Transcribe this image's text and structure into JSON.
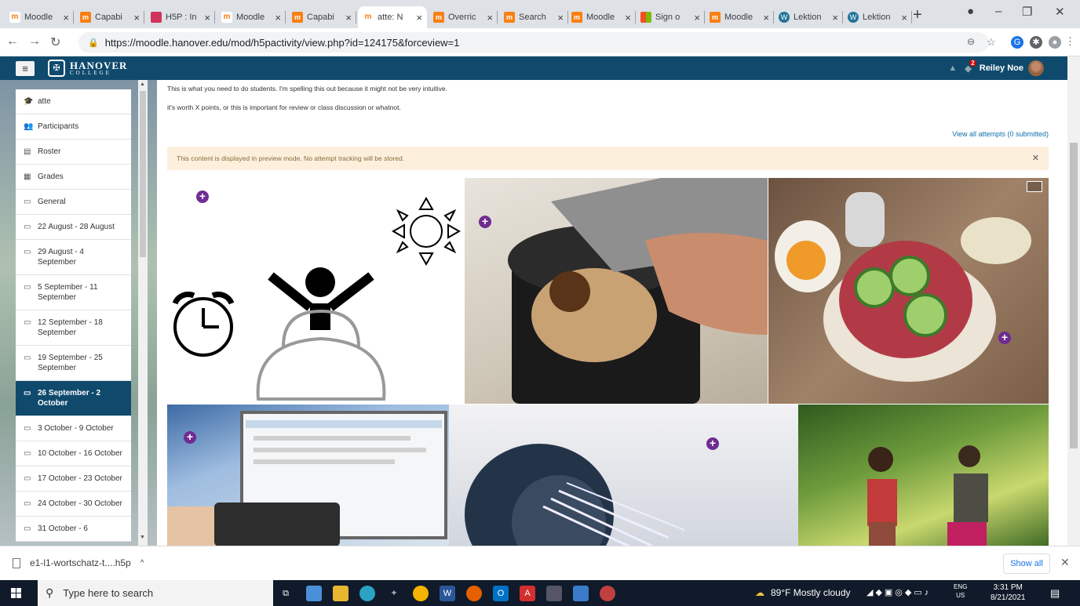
{
  "browser": {
    "tabs": [
      {
        "title": "Moodle",
        "icon": "moodle"
      },
      {
        "title": "Capabi",
        "icon": "m"
      },
      {
        "title": "H5P : In",
        "icon": "h5p"
      },
      {
        "title": "Moodle",
        "icon": "moodle"
      },
      {
        "title": "Capabi",
        "icon": "m"
      },
      {
        "title": "atte: N",
        "icon": "moodle",
        "active": true
      },
      {
        "title": "Overric",
        "icon": "m"
      },
      {
        "title": "Search",
        "icon": "m"
      },
      {
        "title": "Moodle",
        "icon": "m"
      },
      {
        "title": "Sign o",
        "icon": "ms"
      },
      {
        "title": "Moodle",
        "icon": "m"
      },
      {
        "title": "Lektion",
        "icon": "wp"
      },
      {
        "title": "Lektion",
        "icon": "wp"
      }
    ],
    "url": "https://moodle.hanover.edu/mod/h5pactivity/view.php?id=124175&forceview=1",
    "new_tab": "+",
    "close_glyph": "×"
  },
  "site": {
    "logo_name": "HANOVER",
    "logo_sub": "COLLEGE",
    "notification_count": "2",
    "user_name": "Reiley Noe"
  },
  "drawer": {
    "items": [
      {
        "label": "atte",
        "icon": "hat-icon"
      },
      {
        "label": "Participants",
        "icon": "people-icon"
      },
      {
        "label": "Roster",
        "icon": "roster-icon"
      },
      {
        "label": "Grades",
        "icon": "table-icon"
      },
      {
        "label": "General",
        "icon": "folder-icon"
      },
      {
        "label": "22 August - 28 August",
        "icon": "folder-icon"
      },
      {
        "label": "29 August - 4 September",
        "icon": "folder-icon"
      },
      {
        "label": "5 September - 11 September",
        "icon": "folder-icon"
      },
      {
        "label": "12 September - 18 September",
        "icon": "folder-icon"
      },
      {
        "label": "19 September - 25 September",
        "icon": "folder-icon"
      },
      {
        "label": "26 September - 2 October",
        "icon": "folder-icon",
        "active": true
      },
      {
        "label": "3 October - 9 October",
        "icon": "folder-icon"
      },
      {
        "label": "10 October - 16 October",
        "icon": "folder-icon"
      },
      {
        "label": "17 October - 23 October",
        "icon": "folder-icon"
      },
      {
        "label": "24 October - 30 October",
        "icon": "folder-icon"
      },
      {
        "label": "31 October - 6",
        "icon": "folder-icon"
      }
    ]
  },
  "main": {
    "intro_line1": "This is what you need to do students. I'm spelling this out because it might not be very intuitive.",
    "intro_line2": "it's worth X points, or  this is important for review or class discussion or whatnot.",
    "view_all": "View all attempts (0 submitted)",
    "preview_notice": "This content is displayed in preview mode. No attempt tracking will be stored.",
    "hotspot_glyph": "+"
  },
  "downloads": {
    "file_name": "e1-l1-wortschatz-t....h5p",
    "show_all": "Show all"
  },
  "taskbar": {
    "search_placeholder": "Type here to search",
    "weather": "89°F  Mostly cloudy",
    "lang_top": "ENG",
    "lang_bottom": "US",
    "time": "3:31 PM",
    "date": "8/21/2021"
  },
  "colors": {
    "moodle_header": "#0f4a6d",
    "active_nav": "#0f4a6d",
    "hotspot": "#6f2c91",
    "preview_bg": "#fcefdc"
  }
}
